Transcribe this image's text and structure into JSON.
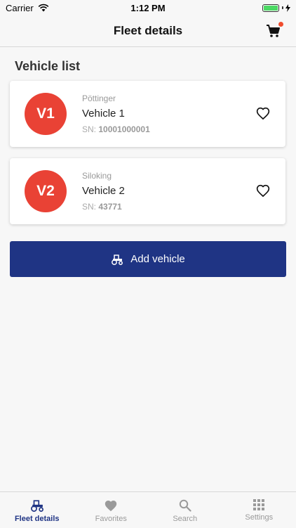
{
  "status_bar": {
    "carrier": "Carrier",
    "time": "1:12 PM"
  },
  "nav": {
    "title": "Fleet details"
  },
  "section": {
    "title": "Vehicle list"
  },
  "vehicles": [
    {
      "avatar": "V1",
      "maker": "Pöttinger",
      "name": "Vehicle 1",
      "sn_label": "SN: ",
      "sn": "10001000001"
    },
    {
      "avatar": "V2",
      "maker": "Siloking",
      "name": "Vehicle 2",
      "sn_label": "SN: ",
      "sn": "43771"
    }
  ],
  "add_button": {
    "label": "Add vehicle"
  },
  "tabs": [
    {
      "label": "Fleet details",
      "icon": "tractor-icon",
      "active": true
    },
    {
      "label": "Favorites",
      "icon": "heart-icon"
    },
    {
      "label": "Search",
      "icon": "search-icon"
    },
    {
      "label": "Settings",
      "icon": "grid-icon"
    }
  ],
  "colors": {
    "accent": "#1f3484",
    "avatar": "#e94235",
    "badge": "#f04c2e",
    "battery": "#4cd964"
  }
}
